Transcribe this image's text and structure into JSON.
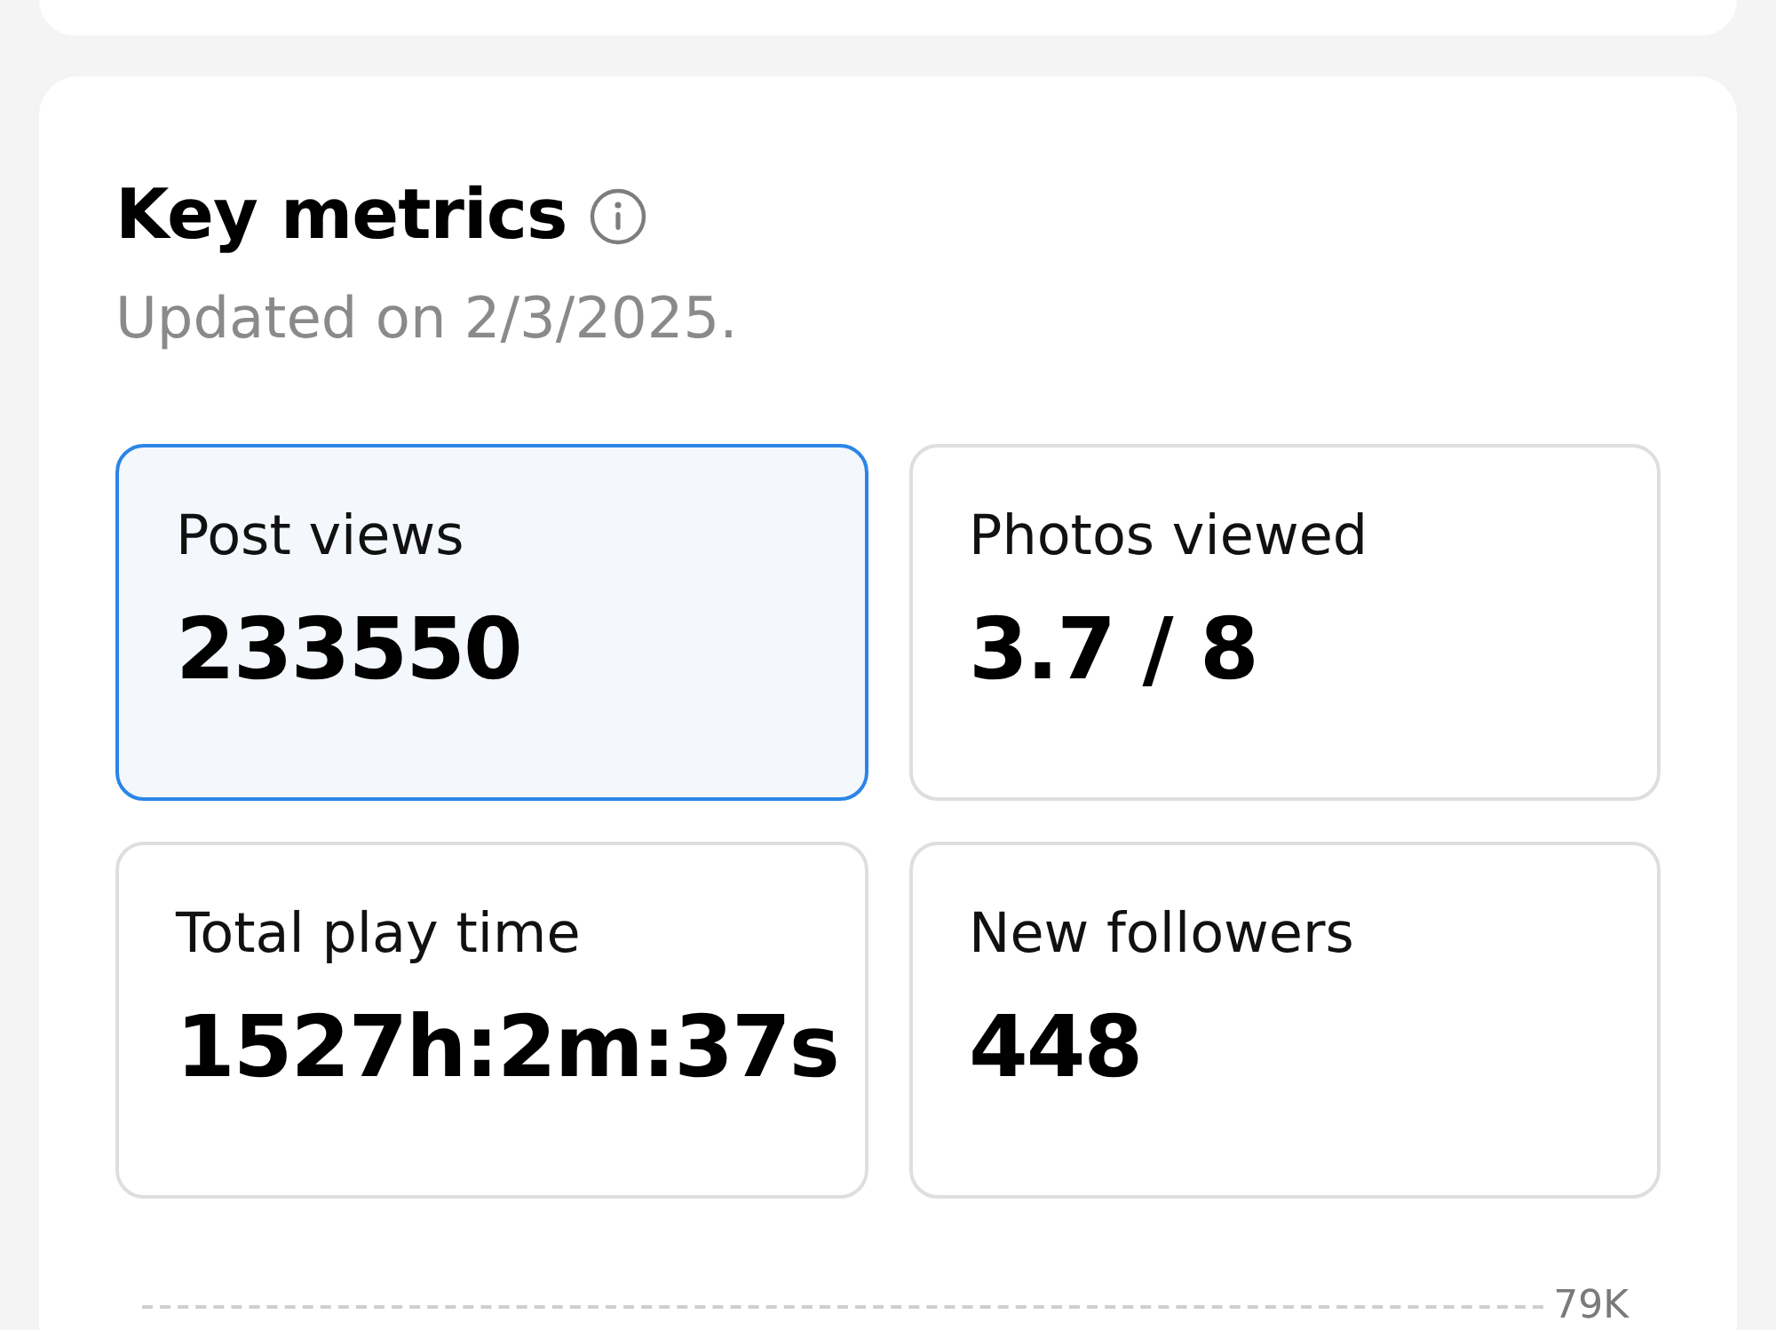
{
  "section": {
    "title": "Key metrics",
    "subtitle": "Updated on 2/3/2025."
  },
  "metrics": [
    {
      "label": "Post views",
      "value": "233550",
      "selected": true
    },
    {
      "label": "Photos viewed",
      "value": "3.7 / 8",
      "selected": false
    },
    {
      "label": "Total play time",
      "value": "1527h:2m:37s",
      "selected": false
    },
    {
      "label": "New followers",
      "value": "448",
      "selected": false
    }
  ],
  "chart": {
    "y_tick_label": "79K"
  }
}
